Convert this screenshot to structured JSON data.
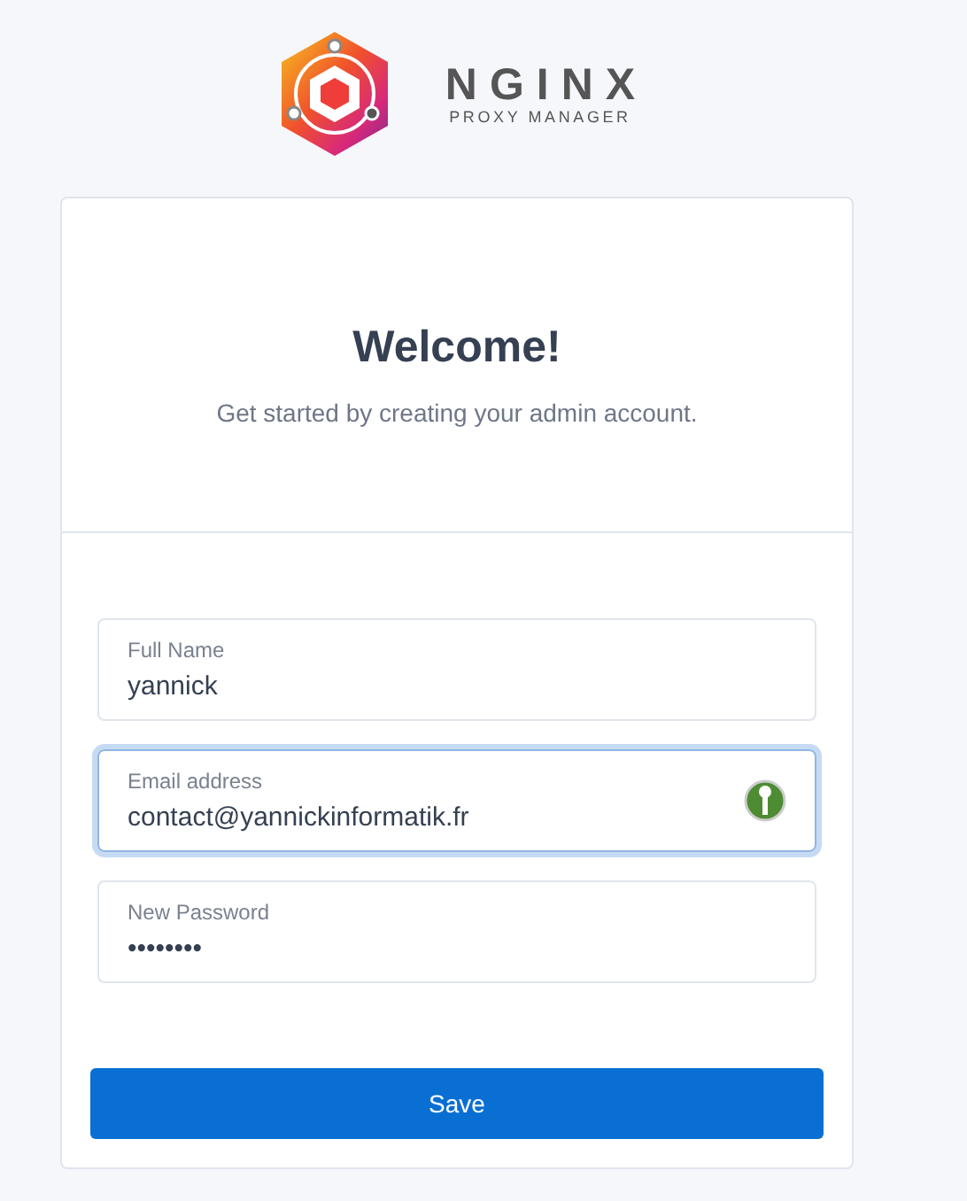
{
  "logo": {
    "title": "NGINX",
    "subtitle": "PROXY MANAGER"
  },
  "card": {
    "title": "Welcome!",
    "subtitle": "Get started by creating your admin account."
  },
  "fields": [
    {
      "label": "Full Name",
      "value": "yannick",
      "focused": false,
      "autofill_icon": false
    },
    {
      "label": "Email address",
      "value": "contact@yannickinformatik.fr",
      "focused": true,
      "autofill_icon": true
    },
    {
      "label": "New Password",
      "value": "••••••••",
      "focused": false,
      "autofill_icon": false
    }
  ],
  "button": "Save"
}
